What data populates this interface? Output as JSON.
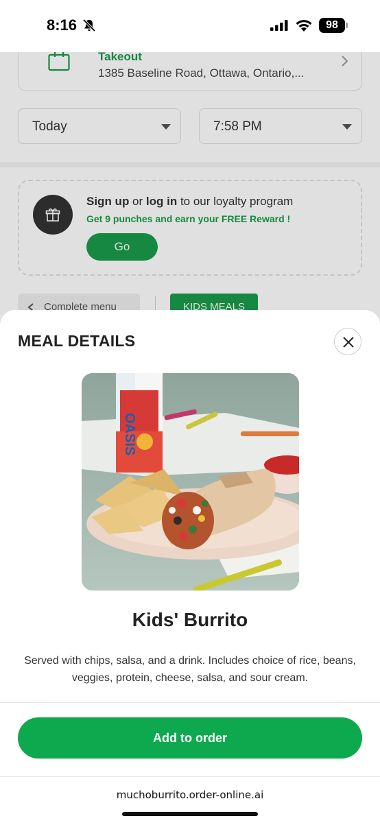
{
  "status_bar": {
    "time": "8:16",
    "battery": "98",
    "icons": [
      "bell-muted-icon",
      "cellular-signal-icon",
      "wifi-icon",
      "battery-icon"
    ]
  },
  "order_setup": {
    "mode": "Takeout",
    "address": "1385 Baseline Road, Ottawa, Ontario,...",
    "date_value": "Today",
    "time_value": "7:58 PM"
  },
  "loyalty": {
    "sign_up": "Sign up",
    "or": " or ",
    "log_in": "log in",
    "suffix": " to our loyalty program",
    "promo": "Get 9 punches and earn your FREE Reward !",
    "go_label": "Go"
  },
  "menu_nav": {
    "complete_menu": "Complete menu",
    "active_category": "KIDS MEALS"
  },
  "meal_details": {
    "title": "MEAL DETAILS",
    "name": "Kids' Burrito",
    "description": "Served with chips, salsa, and a drink. Includes choice of rice, beans, veggies, protein, cheese, salsa, and sour cream.",
    "add_label": "Add to order",
    "image_drink_text": "OASIS"
  },
  "browser": {
    "url": "muchoburrito.order-online.ai"
  },
  "colors": {
    "brand_green": "#1a9b4b",
    "button_green": "#0ea84f"
  }
}
